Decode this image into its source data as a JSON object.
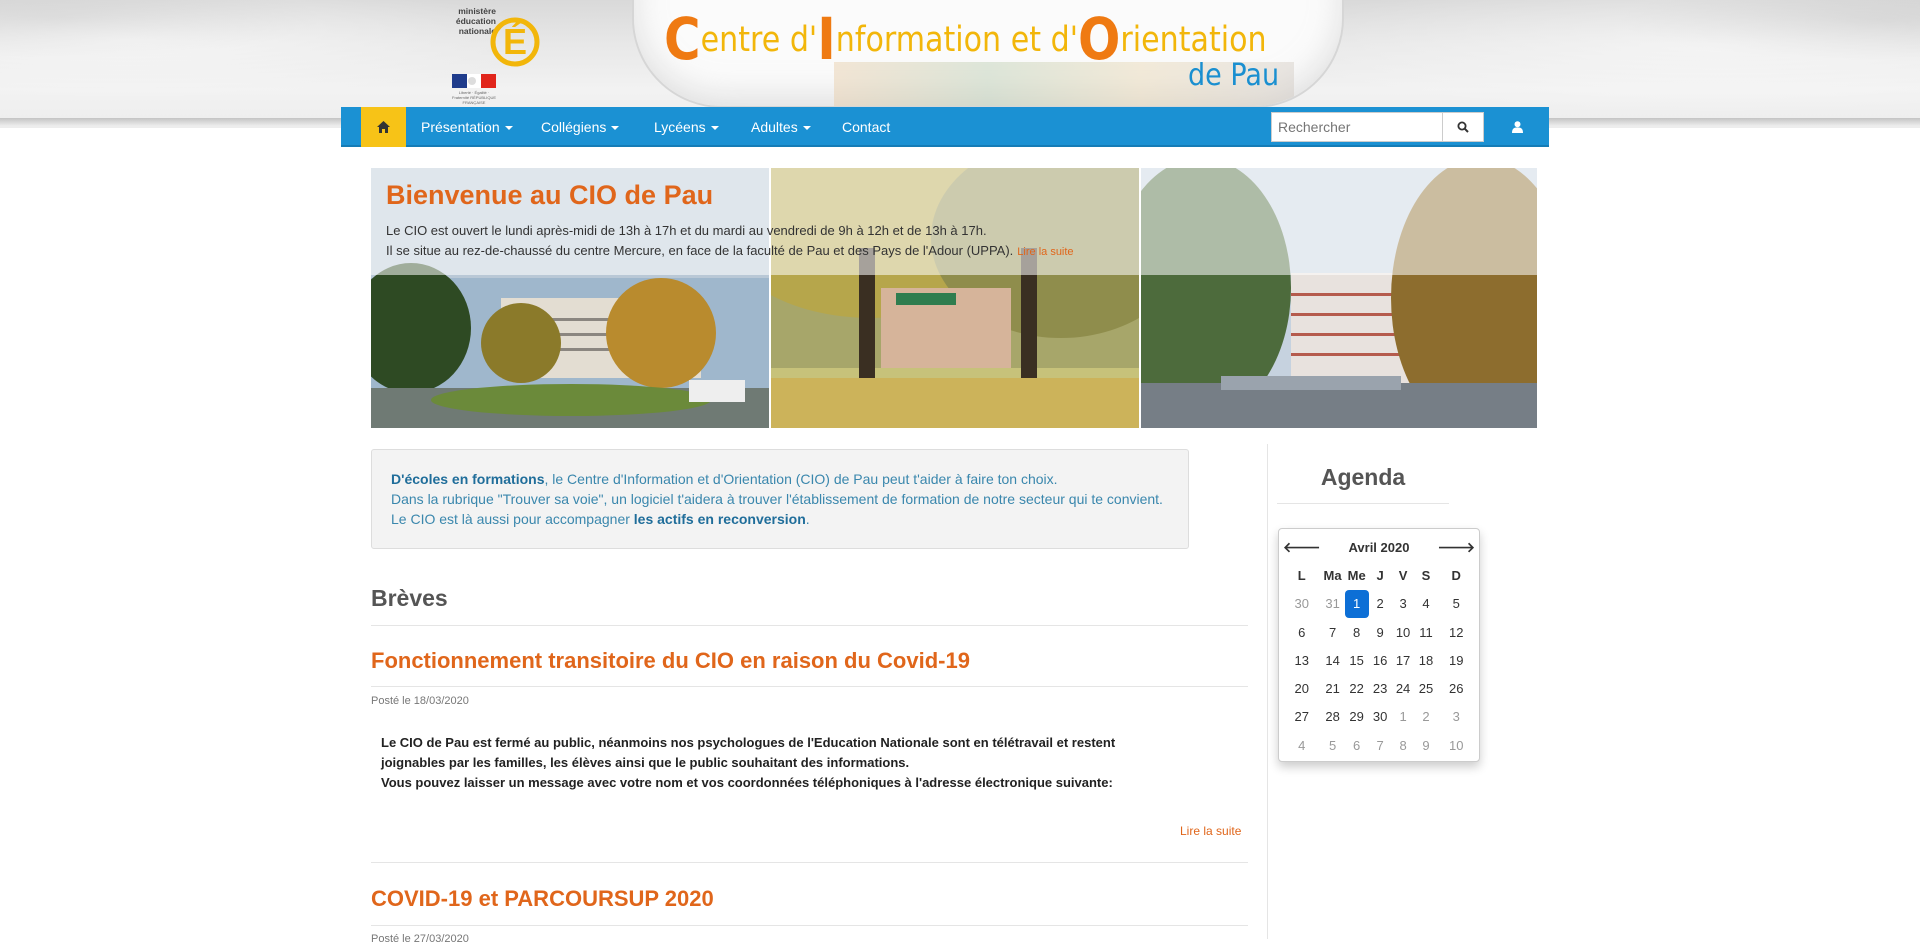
{
  "brand": {
    "ministry_text": "ministère éducation nationale",
    "ministry_letter": "É",
    "republic_text": "Liberté · Égalité · Fraternité RÉPUBLIQUE FRANÇAISE",
    "title_parts": [
      {
        "cap": "C",
        "rest": "entre d'"
      },
      {
        "cap": "I",
        "rest": "nformation et d'"
      },
      {
        "cap": "O",
        "rest": "rientation"
      }
    ],
    "subtitle": "de Pau"
  },
  "nav": {
    "home_icon": "home-icon",
    "items": [
      {
        "label": "Présentation",
        "dropdown": true
      },
      {
        "label": "Collégiens",
        "dropdown": true
      },
      {
        "label": "Lycéens",
        "dropdown": true
      },
      {
        "label": "Adultes",
        "dropdown": true
      },
      {
        "label": "Contact",
        "dropdown": false
      }
    ],
    "search_placeholder": "Rechercher",
    "search_icon": "search-icon",
    "user_icon": "user-icon"
  },
  "hero": {
    "title": "Bienvenue au CIO de Pau",
    "line1": "Le CIO est ouvert le lundi après-midi de 13h à 17h et du mardi au vendredi de 9h à 12h et de 13h à 17h.",
    "line2": "Il se situe au rez-de-chaussé du centre Mercure, en face de la faculté de Pau et des Pays de l'Adour (UPPA).",
    "more": "Lire la suite"
  },
  "info": {
    "l1_strong": "D'écoles en formations",
    "l1_rest": ", le Centre d'Information et d'Orientation (CIO) de Pau peut t'aider à faire ton choix.",
    "l2": "Dans la rubrique \"Trouver sa voie\", un logiciel t'aidera à trouver l'établissement de formation de notre secteur qui te convient.",
    "l3_pre": "Le CIO est là aussi pour accompagner ",
    "l3_strong": "les actifs en reconversion",
    "l3_post": "."
  },
  "breves": {
    "heading": "Brèves",
    "articles": [
      {
        "title": "Fonctionnement transitoire du CIO en raison du Covid-19",
        "date": "Posté le 18/03/2020",
        "body": [
          "Le CIO de Pau est fermé au public, néanmoins nos psychologues de l'Education Nationale sont en télétravail et restent",
          "joignables par les familles, les élèves ainsi que le public souhaitant des informations.",
          "Vous pouvez laisser un message avec votre nom et vos coordonnées téléphoniques à l'adresse électronique suivante:"
        ],
        "more": "Lire la suite"
      },
      {
        "title": "COVID-19 et PARCOURSUP 2020",
        "date": "Posté le 27/03/2020"
      }
    ]
  },
  "agenda": {
    "heading": "Agenda",
    "month": "Avril 2020",
    "prev": "🡐",
    "next": "🡒",
    "days": [
      "L",
      "Ma",
      "Me",
      "J",
      "V",
      "S",
      "D"
    ],
    "weeks": [
      [
        {
          "d": "30",
          "o": true
        },
        {
          "d": "31",
          "o": true
        },
        {
          "d": "1",
          "a": true
        },
        {
          "d": "2"
        },
        {
          "d": "3"
        },
        {
          "d": "4"
        },
        {
          "d": "5"
        }
      ],
      [
        {
          "d": "6"
        },
        {
          "d": "7"
        },
        {
          "d": "8"
        },
        {
          "d": "9"
        },
        {
          "d": "10"
        },
        {
          "d": "11"
        },
        {
          "d": "12"
        }
      ],
      [
        {
          "d": "13"
        },
        {
          "d": "14"
        },
        {
          "d": "15"
        },
        {
          "d": "16"
        },
        {
          "d": "17"
        },
        {
          "d": "18"
        },
        {
          "d": "19"
        }
      ],
      [
        {
          "d": "20"
        },
        {
          "d": "21"
        },
        {
          "d": "22"
        },
        {
          "d": "23"
        },
        {
          "d": "24"
        },
        {
          "d": "25"
        },
        {
          "d": "26"
        }
      ],
      [
        {
          "d": "27"
        },
        {
          "d": "28"
        },
        {
          "d": "29"
        },
        {
          "d": "30"
        },
        {
          "d": "1",
          "o": true
        },
        {
          "d": "2",
          "o": true
        },
        {
          "d": "3",
          "o": true
        }
      ],
      [
        {
          "d": "4",
          "o": true
        },
        {
          "d": "5",
          "o": true
        },
        {
          "d": "6",
          "o": true
        },
        {
          "d": "7",
          "o": true
        },
        {
          "d": "8",
          "o": true
        },
        {
          "d": "9",
          "o": true
        },
        {
          "d": "10",
          "o": true
        }
      ]
    ]
  },
  "colors": {
    "nav": "#1b91d3",
    "home": "#f7c317",
    "accent": "#e0661b",
    "calendar_active": "#0d6fd6"
  }
}
